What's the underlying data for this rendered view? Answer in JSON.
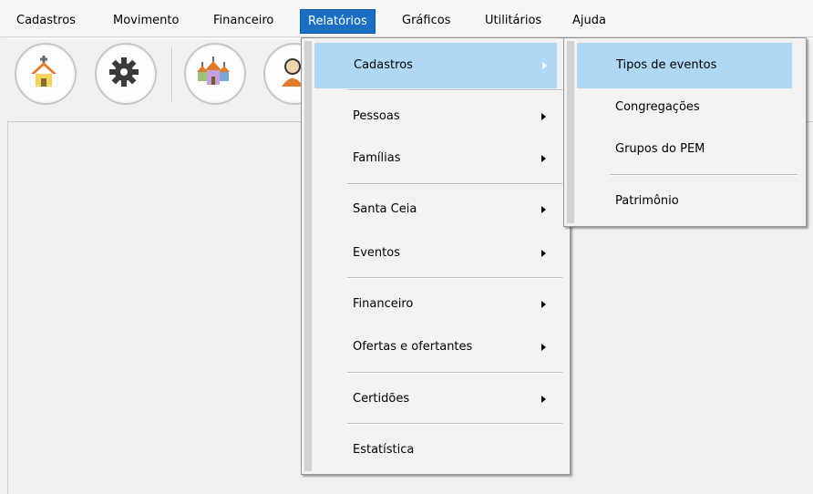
{
  "menubar": {
    "items": [
      {
        "label": "Cadastros"
      },
      {
        "label": "Movimento"
      },
      {
        "label": "Financeiro"
      },
      {
        "label": "Relatórios"
      },
      {
        "label": "Gráficos"
      },
      {
        "label": "Utilitários"
      },
      {
        "label": "Ajuda"
      }
    ]
  },
  "toolbar": {
    "buttons": [
      {
        "icon": "church-icon"
      },
      {
        "icon": "gear-icon"
      },
      {
        "icon": "churches-icon"
      },
      {
        "icon": "person-icon"
      }
    ]
  },
  "relatorios_menu": {
    "items": [
      {
        "label": "Cadastros",
        "has_submenu": true
      },
      {
        "label": "Pessoas",
        "has_submenu": true
      },
      {
        "label": "Famílias",
        "has_submenu": true
      },
      {
        "label": "Santa Ceia",
        "has_submenu": true
      },
      {
        "label": "Eventos",
        "has_submenu": true
      },
      {
        "label": "Financeiro",
        "has_submenu": true
      },
      {
        "label": "Ofertas e ofertantes",
        "has_submenu": true
      },
      {
        "label": "Certidões",
        "has_submenu": true
      },
      {
        "label": "Estatística",
        "has_submenu": false
      }
    ]
  },
  "cadastros_submenu": {
    "items": [
      {
        "label": "Tipos de eventos"
      },
      {
        "label": "Congregações"
      },
      {
        "label": "Grupos do PEM"
      },
      {
        "label": "Patrimônio"
      }
    ]
  },
  "colors": {
    "menu_highlight": "#aed8f3",
    "menubar_active": "#1a6fc2"
  }
}
